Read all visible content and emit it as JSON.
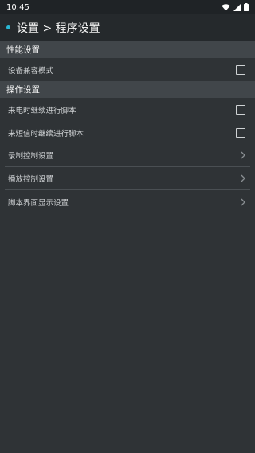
{
  "status_bar": {
    "time": "10:45"
  },
  "title_bar": {
    "title": "设置 > 程序设置"
  },
  "sections": [
    {
      "header": "性能设置",
      "items": [
        {
          "label": "设备兼容模式",
          "control": "checkbox",
          "checked": false
        }
      ]
    },
    {
      "header": "操作设置",
      "items": [
        {
          "label": "来电时继续进行脚本",
          "control": "checkbox",
          "checked": false
        },
        {
          "label": "来短信时继续进行脚本",
          "control": "checkbox",
          "checked": false
        },
        {
          "label": "录制控制设置",
          "control": "chevron"
        },
        {
          "label": "播放控制设置",
          "control": "chevron"
        },
        {
          "label": "脚本界面显示设置",
          "control": "chevron"
        }
      ]
    }
  ],
  "colors": {
    "background": "#2f3336",
    "title_bar": "#25292c",
    "section_header": "#41464a",
    "accent_dot": "#29b7d3"
  }
}
